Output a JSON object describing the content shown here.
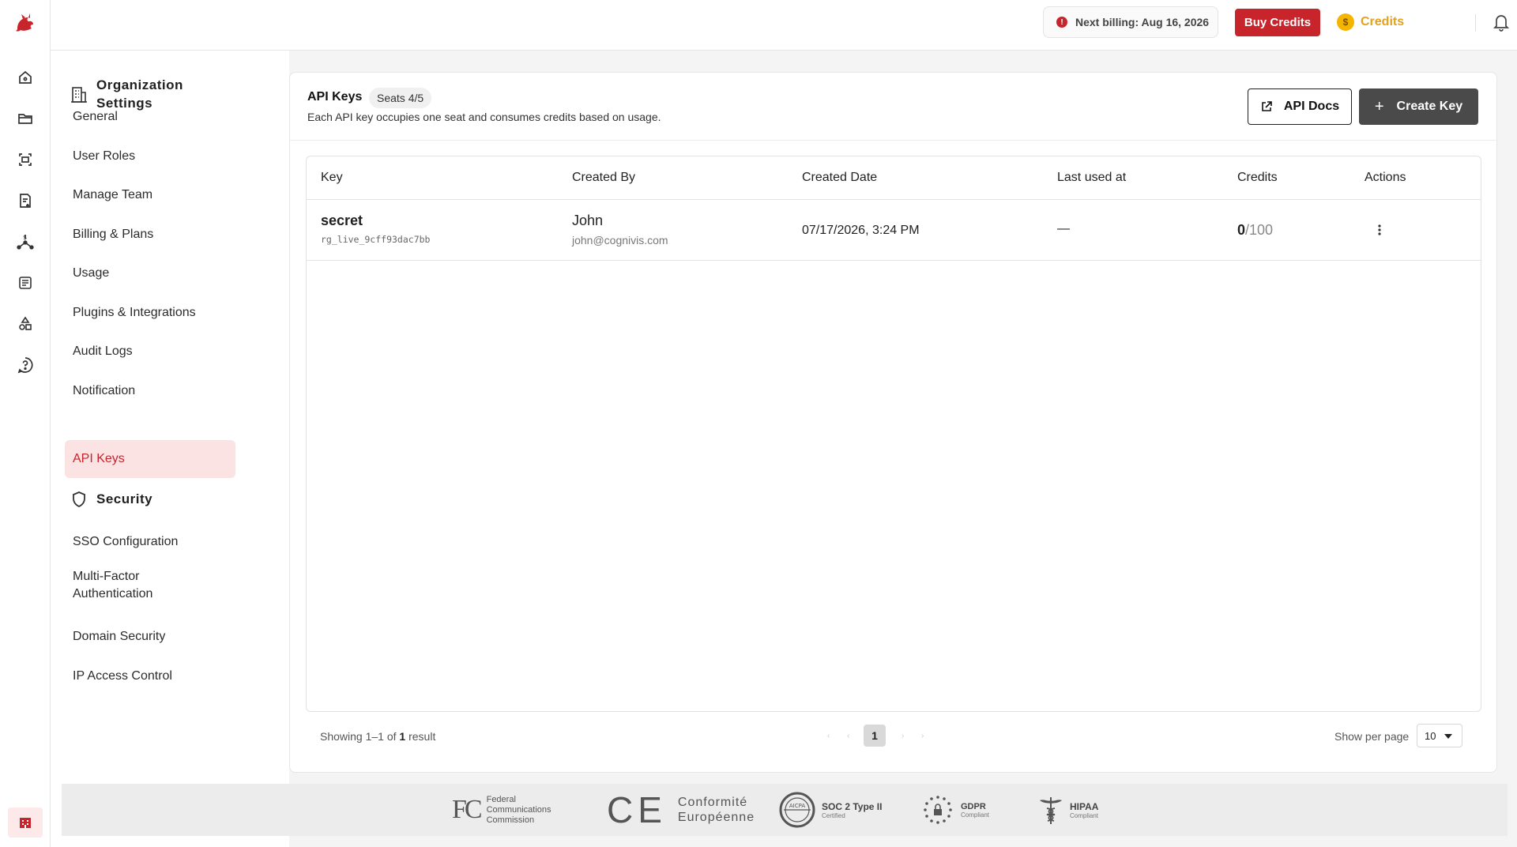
{
  "rail": {
    "icons": [
      "home-icon",
      "folder-icon",
      "scan-icon",
      "document-add-icon",
      "billing-flow-icon",
      "list-icon",
      "shapes-icon",
      "help-circle-icon"
    ],
    "bottom_icon": "organization-icon"
  },
  "topbar": {
    "billing_text": "Next billing: Aug 16, 2026",
    "buy_label": "Buy Credits",
    "credits_label": "Credits",
    "coin_symbol": "$"
  },
  "nav": {
    "org_heading": "Organization Settings",
    "org_items": [
      "General",
      "User Roles",
      "Manage Team",
      "Billing & Plans",
      "Usage",
      "Plugins & Integrations",
      "Audit Logs",
      "Notification",
      "API Keys"
    ],
    "active_item": "API Keys",
    "security_heading": "Security",
    "security_items": [
      "SSO Configuration",
      "Multi-Factor Authentication",
      "Domain Security",
      "IP Access Control"
    ]
  },
  "card": {
    "title": "API Keys",
    "seats": "Seats 4/5",
    "subtitle": "Each API key occupies one seat and consumes credits based on usage.",
    "docs_label": "API Docs",
    "create_label": "Create Key"
  },
  "table": {
    "columns": [
      "Key",
      "Created By",
      "Created Date",
      "Last used at",
      "Credits",
      "Actions"
    ],
    "rows": [
      {
        "key_name": "secret",
        "key_value": "rg_live_9cff93dac7bb",
        "created_by_name": "John",
        "created_by_email": "john@cognivis.com",
        "created_date": "07/17/2026, 3:24 PM",
        "last_used": "—",
        "credits_used": "0",
        "credits_total": "/100"
      }
    ]
  },
  "pager": {
    "showing_prefix": "Showing 1–1 of ",
    "showing_count": "1",
    "showing_suffix": " result",
    "current_page": "1",
    "per_page_label": "Show per page",
    "per_page_value": "10"
  },
  "compliance": {
    "fcc_lines": [
      "Federal",
      "Communications",
      "Commission"
    ],
    "fcc_mark": "FC",
    "ce_mark": "CE",
    "ce_lines": [
      "Conformité",
      "Européenne"
    ],
    "soc_title": "SOC 2 Type II",
    "soc_sub": "Certified",
    "soc_seal": "AICPA",
    "gdpr_title": "GDPR",
    "gdpr_sub": "Compliant",
    "hipaa_title": "HIPAA",
    "hipaa_sub": "Compliant"
  },
  "colors": {
    "brand_red": "#c8242c",
    "active_bg": "#fbe3e4",
    "credits_gold": "#e5a11a",
    "create_btn": "#4a4a4a"
  }
}
